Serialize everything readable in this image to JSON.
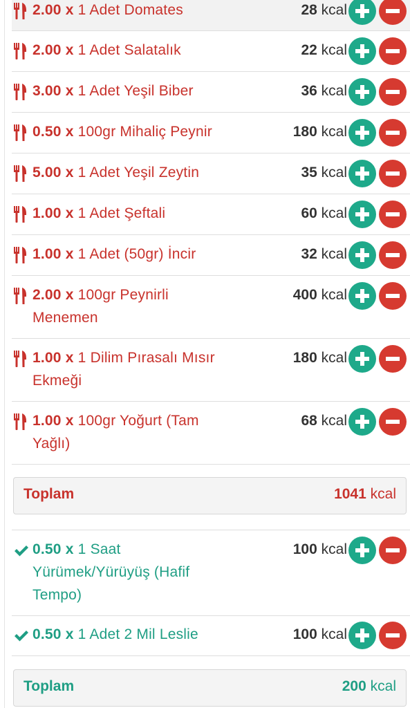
{
  "food_items": [
    {
      "qty": "2.00",
      "times": "x",
      "desc": "1 Adet Domates",
      "kcal": "28",
      "unit": "kcal"
    },
    {
      "qty": "2.00",
      "times": "x",
      "desc": "1 Adet Salatalık",
      "kcal": "22",
      "unit": "kcal"
    },
    {
      "qty": "3.00",
      "times": "x",
      "desc": "1 Adet Yeşil Biber",
      "kcal": "36",
      "unit": "kcal"
    },
    {
      "qty": "0.50",
      "times": "x",
      "desc": "100gr Mihaliç Peynir",
      "kcal": "180",
      "unit": "kcal"
    },
    {
      "qty": "5.00",
      "times": "x",
      "desc": "1 Adet Yeşil Zeytin",
      "kcal": "35",
      "unit": "kcal"
    },
    {
      "qty": "1.00",
      "times": "x",
      "desc": "1 Adet Şeftali",
      "kcal": "60",
      "unit": "kcal"
    },
    {
      "qty": "1.00",
      "times": "x",
      "desc": "1 Adet (50gr) İncir",
      "kcal": "32",
      "unit": "kcal"
    },
    {
      "qty": "2.00",
      "times": "x",
      "desc": "100gr Peynirli Menemen",
      "kcal": "400",
      "unit": "kcal"
    },
    {
      "qty": "1.00",
      "times": "x",
      "desc": "1 Dilim Pırasalı Mısır Ekmeği",
      "kcal": "180",
      "unit": "kcal"
    },
    {
      "qty": "1.00",
      "times": "x",
      "desc": "100gr Yoğurt (Tam Yağlı)",
      "kcal": "68",
      "unit": "kcal"
    }
  ],
  "food_total": {
    "label": "Toplam",
    "value": "1041",
    "unit": "kcal"
  },
  "activity_items": [
    {
      "qty": "0.50",
      "times": "x",
      "desc": "1 Saat Yürümek/Yürüyüş (Hafif Tempo)",
      "kcal": "100",
      "unit": "kcal"
    },
    {
      "qty": "0.50",
      "times": "x",
      "desc": "1 Adet 2 Mil Leslie",
      "kcal": "100",
      "unit": "kcal"
    }
  ],
  "activity_total": {
    "label": "Toplam",
    "value": "200",
    "unit": "kcal"
  },
  "colors": {
    "food": "#c8322c",
    "activity": "#1f9e84",
    "plus": "#1ea98a",
    "minus": "#d63a30"
  },
  "icons": {
    "food": "fork-knife-icon",
    "activity": "checkmark-icon",
    "plus": "plus-circle-icon",
    "minus": "minus-circle-icon"
  }
}
